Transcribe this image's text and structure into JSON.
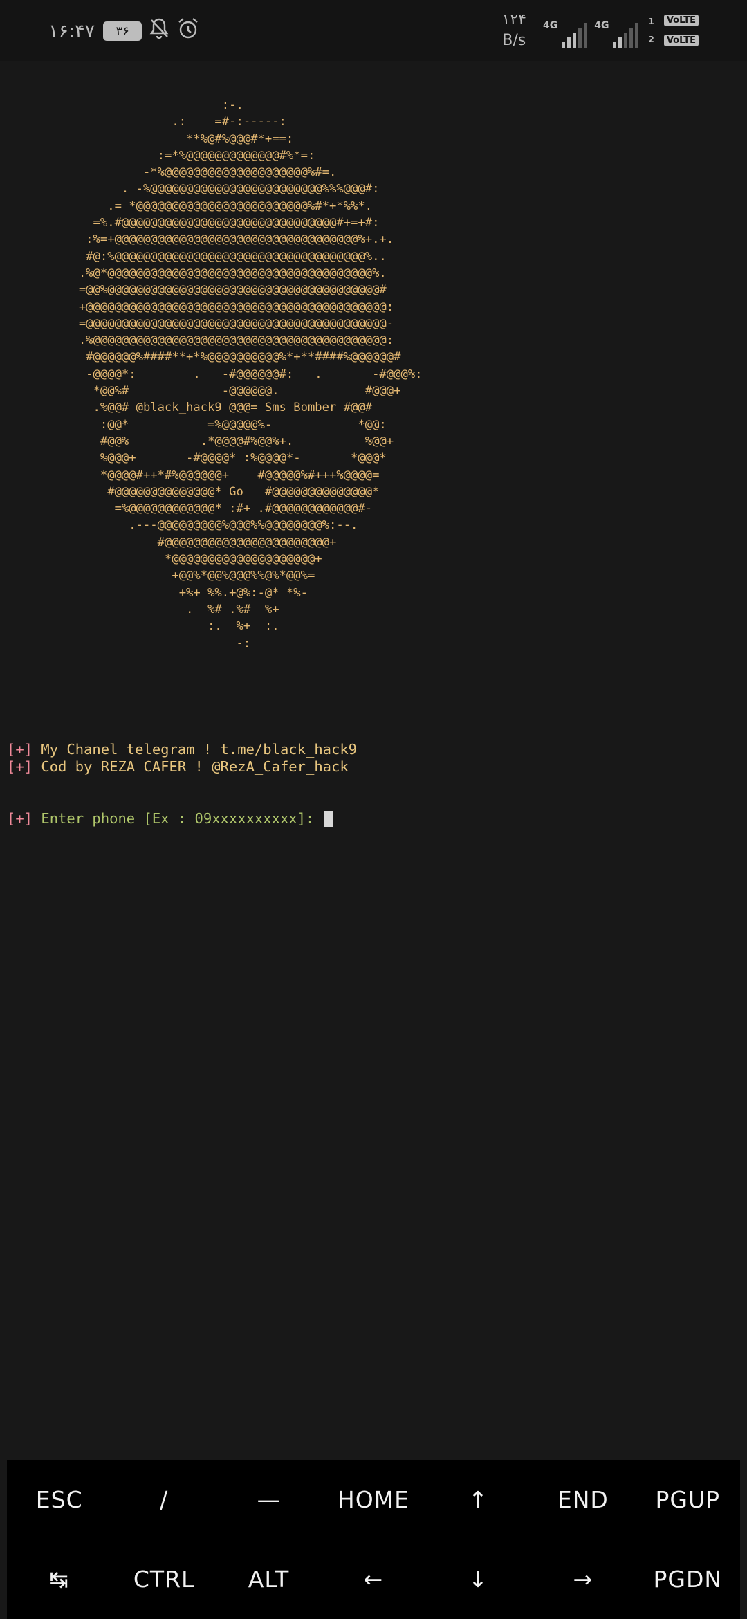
{
  "status_bar": {
    "time": "۱۶:۴۷",
    "battery": "۳۶",
    "speed_value": "۱۲۴",
    "speed_unit": "B/s",
    "net1": "4G",
    "net2": "4G",
    "sim1": "1",
    "sim2": "2",
    "volte1": "VoLTE",
    "volte2": "VoLTE",
    "icons": [
      "bell-off-icon",
      "alarm-icon",
      "signal-icon"
    ]
  },
  "terminal": {
    "ascii_art": "                               :-.\n                        .:    =#-:-----:\n                          **%@#%@@@#*+==:\n                      :=*%@@@@@@@@@@@@@#%*=:\n                    -*%@@@@@@@@@@@@@@@@@@@@%#=.\n                 . -%@@@@@@@@@@@@@@@@@@@@@@@@%%%@@@#:\n               .= *@@@@@@@@@@@@@@@@@@@@@@@@%#*+*%%*.\n             =%.#@@@@@@@@@@@@@@@@@@@@@@@@@@@@@@#+=+#:\n            :%=+@@@@@@@@@@@@@@@@@@@@@@@@@@@@@@@@@@%+.+.\n            #@:%@@@@@@@@@@@@@@@@@@@@@@@@@@@@@@@@@@@%..\n           .%@*@@@@@@@@@@@@@@@@@@@@@@@@@@@@@@@@@@@@@%.\n           =@@%@@@@@@@@@@@@@@@@@@@@@@@@@@@@@@@@@@@@@@#\n           +@@@@@@@@@@@@@@@@@@@@@@@@@@@@@@@@@@@@@@@@@@:\n           =@@@@@@@@@@@@@@@@@@@@@@@@@@@@@@@@@@@@@@@@@@-\n           .%@@@@@@@@@@@@@@@@@@@@@@@@@@@@@@@@@@@@@@@@@:\n            #@@@@@@%####**+*%@@@@@@@@@@%*+**####%@@@@@@#\n            -@@@@*:        .   -#@@@@@@#:   .       -#@@@%:\n             *@@%#             -@@@@@@.            #@@@+\n             .%@@# @black_hack9 @@@= Sms Bomber #@@#\n              :@@*           =%@@@@@%-            *@@:\n              #@@%          .*@@@@#%@@%+.          %@@+\n              %@@@+       -#@@@@* :%@@@@*-       *@@@*\n              *@@@@#++*#%@@@@@@+    #@@@@@%#+++%@@@@=\n               #@@@@@@@@@@@@@@* Go   #@@@@@@@@@@@@@@*\n                =%@@@@@@@@@@@@* :#+ .#@@@@@@@@@@@@#-\n                  .---@@@@@@@@@%@@@%%@@@@@@@@%:--.\n                      #@@@@@@@@@@@@@@@@@@@@@@@+\n                       *@@@@@@@@@@@@@@@@@@@@+\n                        +@@%*@@%@@@%%@%*@@%=\n                         +%+ %%.+@%:-@* *%-\n                          .  %# .%#  %+\n                             :.  %+  :.\n                                 -:",
    "lines": [
      {
        "bracket": "[+]",
        "text": " My Chanel telegram ! t.me/black_hack9"
      },
      {
        "bracket": "[+]",
        "text": " Cod by REZA CAFER ! @RezA_Cafer_hack"
      }
    ],
    "prompt_bracket": "[+]",
    "prompt_text": " Enter phone [Ex : 09xxxxxxxxxx]: "
  },
  "extra_keys": {
    "row1": [
      "ESC",
      "/",
      "—",
      "HOME",
      "↑",
      "END",
      "PGUP"
    ],
    "row2": [
      "↹",
      "CTRL",
      "ALT",
      "←",
      "↓",
      "→",
      "PGDN"
    ]
  }
}
